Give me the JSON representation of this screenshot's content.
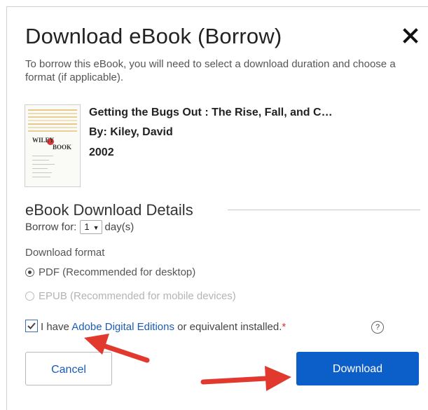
{
  "dialog": {
    "title": "Download eBook (Borrow)",
    "close_icon": "close-icon",
    "intro": "To borrow this eBook, you will need to select a download duration and choose a format (if applicable)."
  },
  "book": {
    "title": "Getting the Bugs Out : The Rise, Fall, and C…",
    "author": "By: Kiley, David",
    "year": "2002",
    "cover_text_1": "WILEY",
    "cover_text_2": "BOOK"
  },
  "details": {
    "heading": "eBook Download Details",
    "borrow_label": "Borrow for:",
    "borrow_value": "1",
    "borrow_unit": "day(s)",
    "format_label": "Download format",
    "formats": [
      {
        "label": "PDF (Recommended for desktop)",
        "selected": true,
        "enabled": true
      },
      {
        "label": "EPUB (Recommended for mobile devices)",
        "selected": false,
        "enabled": false
      }
    ]
  },
  "acknowledge": {
    "checked": true,
    "prefix": "I have ",
    "link": "Adobe Digital Editions",
    "suffix": " or equivalent installed.",
    "required_mark": "*",
    "help_icon": "help-icon",
    "help_glyph": "?"
  },
  "buttons": {
    "cancel": "Cancel",
    "download": "Download"
  },
  "colors": {
    "primary": "#0c5ec9",
    "link": "#1a5bb8",
    "required": "#d9342b",
    "annotation_arrow": "#e2392e"
  }
}
